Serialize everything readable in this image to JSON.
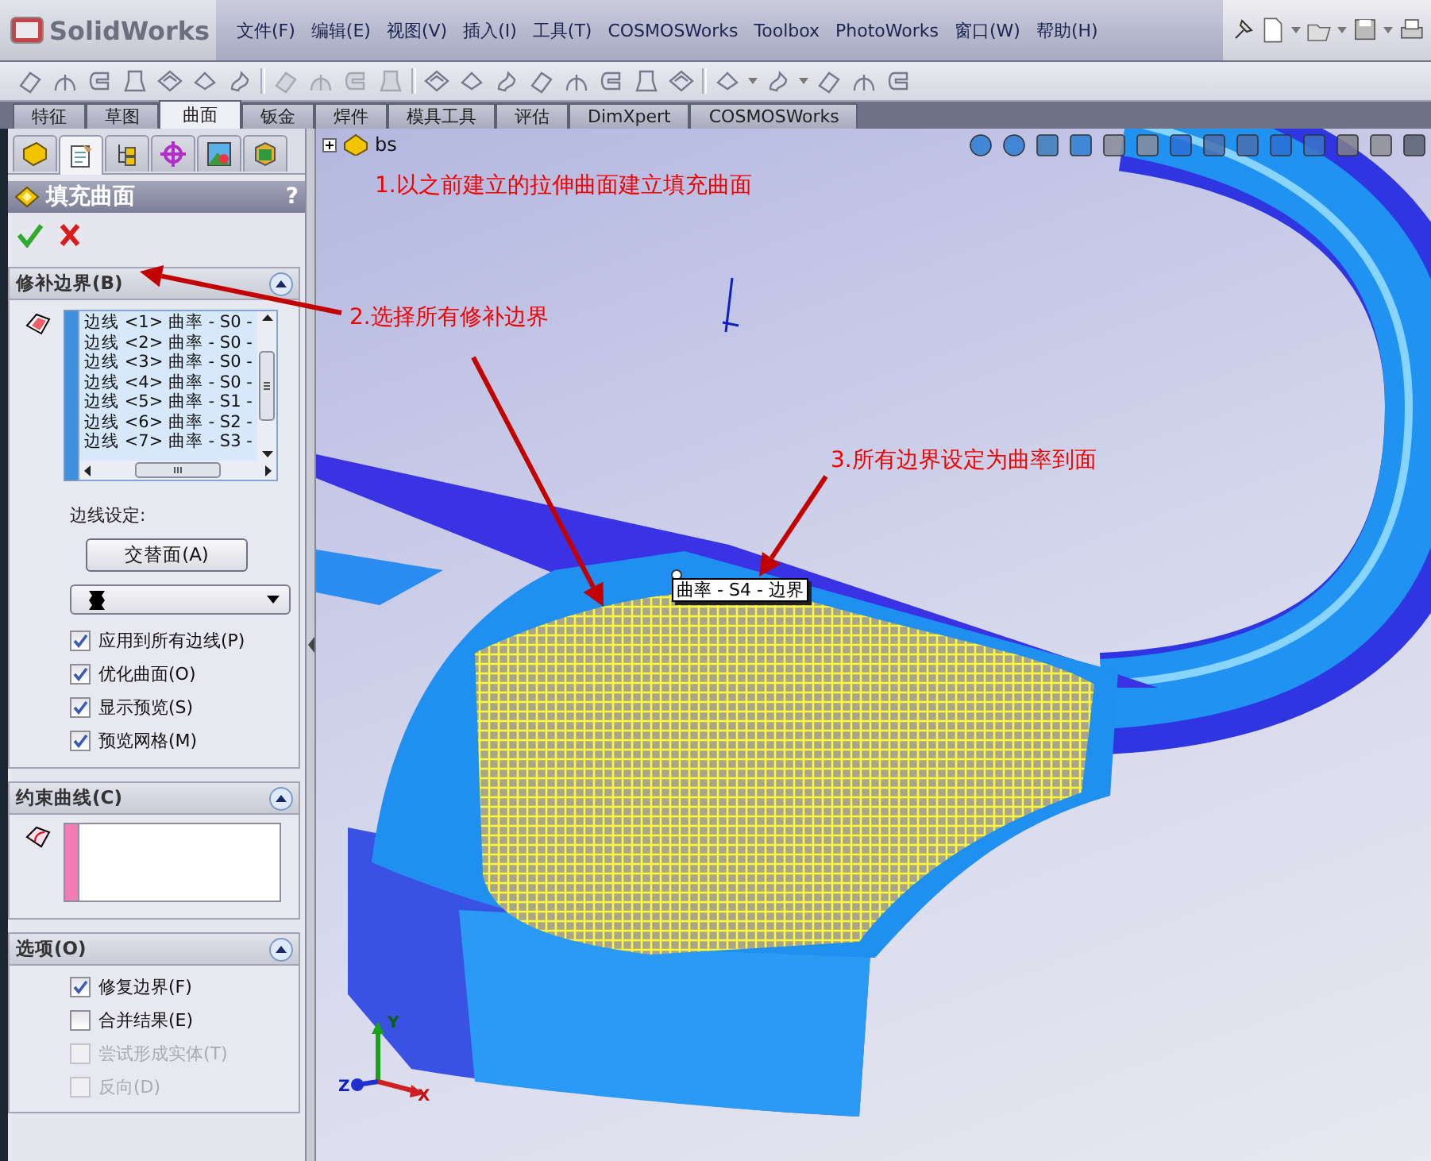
{
  "app": {
    "logo": "SolidWorks",
    "menu": [
      "文件(F)",
      "编辑(E)",
      "视图(V)",
      "插入(I)",
      "工具(T)",
      "COSMOSWorks",
      "Toolbox",
      "PhotoWorks",
      "窗口(W)",
      "帮助(H)"
    ]
  },
  "command_tabs": [
    {
      "label": "特征",
      "selected": false
    },
    {
      "label": "草图",
      "selected": false
    },
    {
      "label": "曲面",
      "selected": true
    },
    {
      "label": "钣金",
      "selected": false
    },
    {
      "label": "焊件",
      "selected": false
    },
    {
      "label": "模具工具",
      "selected": false
    },
    {
      "label": "评估",
      "selected": false
    },
    {
      "label": "DimXpert",
      "selected": false
    },
    {
      "label": "COSMOSWorks",
      "selected": false
    }
  ],
  "property_manager": {
    "tabs": [
      {
        "selected": false
      },
      {
        "selected": true
      },
      {
        "selected": false
      },
      {
        "selected": false
      },
      {
        "selected": false
      },
      {
        "selected": false
      }
    ],
    "title": "填充曲面",
    "help": "?",
    "patch_boundary": {
      "title": "修补边界(B)",
      "items": [
        "边线 <1> 曲率 - S0 -",
        "边线 <2> 曲率 - S0 -",
        "边线 <3> 曲率 - S0 -",
        "边线 <4> 曲率 - S0 -",
        "边线 <5> 曲率 - S1 -",
        "边线 <6> 曲率 - S2 -",
        "边线 <7> 曲率 - S3 -"
      ],
      "edge_settings_label": "边线设定:",
      "alternate_face_button": "交替面(A)",
      "checkboxes": [
        {
          "label": "应用到所有边线(P)",
          "checked": true
        },
        {
          "label": "优化曲面(O)",
          "checked": true
        },
        {
          "label": "显示预览(S)",
          "checked": true
        },
        {
          "label": "预览网格(M)",
          "checked": true
        }
      ]
    },
    "constraint_curves": {
      "title": "约束曲线(C)"
    },
    "options": {
      "title": "选项(O)",
      "checkboxes": [
        {
          "label": "修复边界(F)",
          "checked": true,
          "disabled": false
        },
        {
          "label": "合并结果(E)",
          "checked": false,
          "disabled": false
        },
        {
          "label": "尝试形成实体(T)",
          "checked": false,
          "disabled": true
        },
        {
          "label": "反向(D)",
          "checked": false,
          "disabled": true
        }
      ]
    }
  },
  "viewport": {
    "tree_item": "bs",
    "tooltip": "曲率 - S4 - 边界",
    "triad": [
      "X",
      "Y",
      "Z"
    ],
    "annotations": [
      "1.以之前建立的拉伸曲面建立填充曲面",
      "2.选择所有修补边界",
      "3.所有边界设定为曲率到面"
    ]
  }
}
